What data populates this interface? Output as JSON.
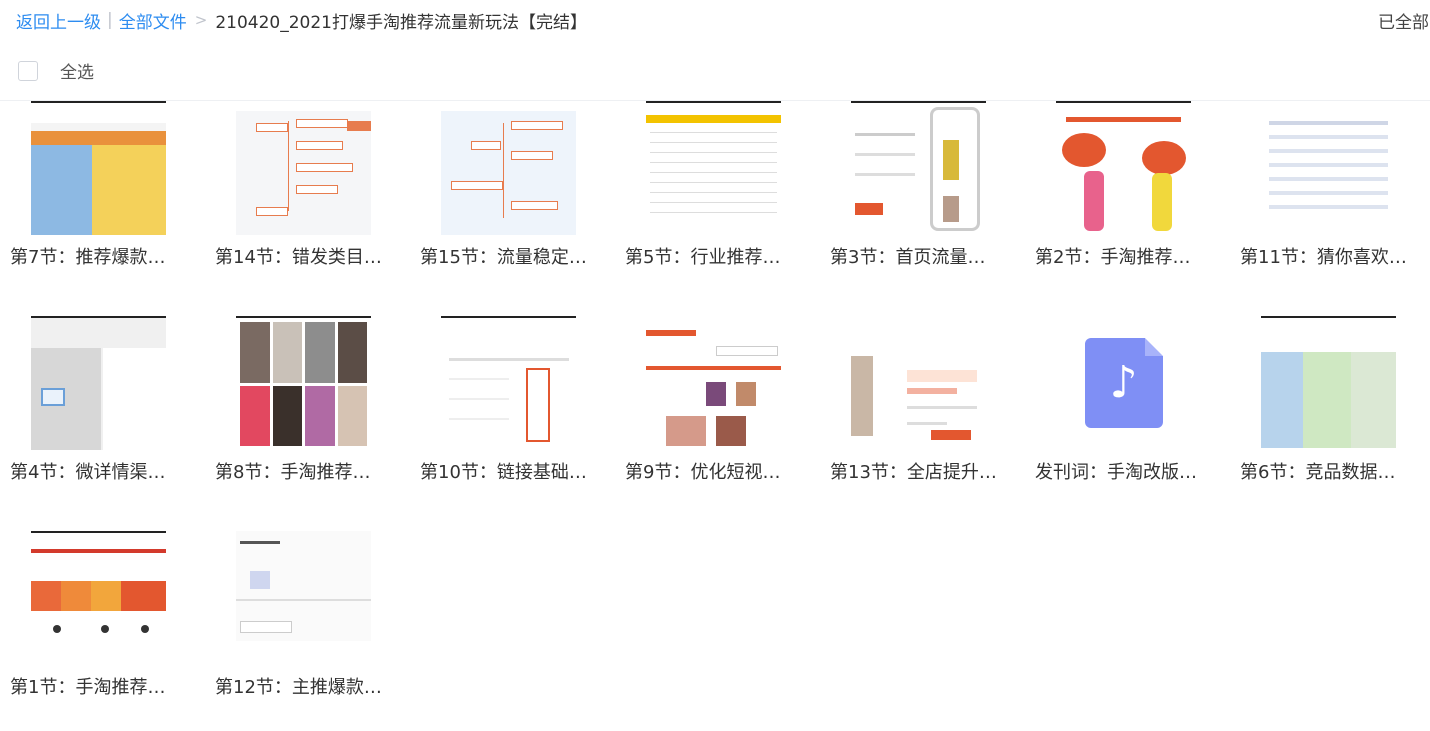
{
  "breadcrumb": {
    "back": "返回上一级",
    "separator": "|",
    "all_files": "全部文件",
    "arrow": ">",
    "current": "210420_2021打爆手淘推荐流量新玩法【完结】"
  },
  "status": {
    "loaded": "已全部"
  },
  "select_all": {
    "label": "全选",
    "checked": false
  },
  "files": [
    {
      "name": "第7节：推荐爆款…",
      "thumb": "spread-blue-yellow"
    },
    {
      "name": "第14节：错发类目…",
      "thumb": "mind-map"
    },
    {
      "name": "第15节：流量稳定…",
      "thumb": "mind-map-blue"
    },
    {
      "name": "第5节：行业推荐…",
      "thumb": "table-yellow-header"
    },
    {
      "name": "第3节：首页流量…",
      "thumb": "phone-screenshot"
    },
    {
      "name": "第2节：手淘推荐…",
      "thumb": "cartoon-shoppers"
    },
    {
      "name": "第11节：猜你喜欢…",
      "thumb": "list-doc"
    },
    {
      "name": "第4节：微详情渠…",
      "thumb": "gray-doc"
    },
    {
      "name": "第8节：手淘推荐…",
      "thumb": "product-photos"
    },
    {
      "name": "第10节：链接基础…",
      "thumb": "form-red-outline"
    },
    {
      "name": "第9节：优化短视…",
      "thumb": "shop-page"
    },
    {
      "name": "第13节：全店提升…",
      "thumb": "product-price-page"
    },
    {
      "name": "发刊词：手淘改版…",
      "thumb": "audio-icon"
    },
    {
      "name": "第6节：竞品数据…",
      "thumb": "spread-green"
    },
    {
      "name": "第1节：手淘推荐…",
      "thumb": "puzzle-diagram"
    },
    {
      "name": "第12节：主推爆款…",
      "thumb": "settings-form"
    }
  ],
  "colors": {
    "link": "#2d8cf0",
    "audio_icon": "#7f8ff5"
  }
}
